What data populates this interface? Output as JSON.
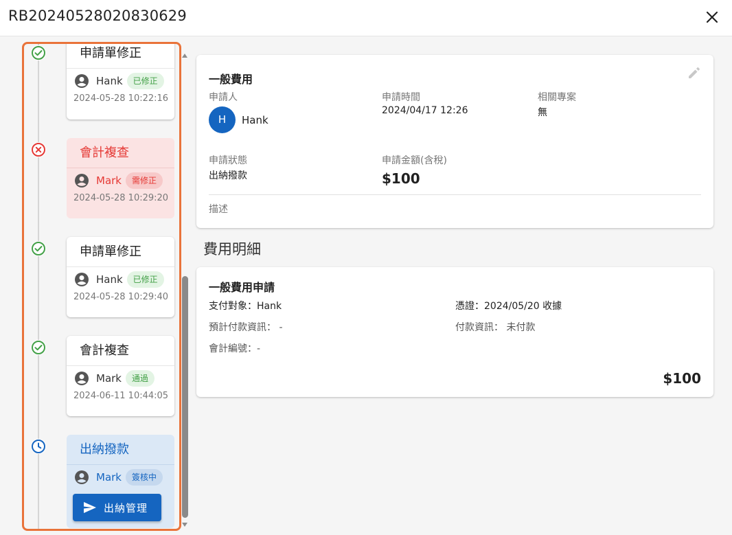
{
  "header": {
    "title": "RB20240528020830629"
  },
  "timeline": {
    "steps": [
      {
        "status": "done",
        "title": "申請單修正",
        "user": "Hank",
        "badge": "已修正",
        "time": "2024-05-28 10:22:16"
      },
      {
        "status": "rejected",
        "title": "會計複查",
        "user": "Mark",
        "badge": "需修正",
        "time": "2024-05-28 10:29:20"
      },
      {
        "status": "done",
        "title": "申請單修正",
        "user": "Hank",
        "badge": "已修正",
        "time": "2024-05-28 10:29:40"
      },
      {
        "status": "done",
        "title": "會計複查",
        "user": "Mark",
        "badge": "通過",
        "time": "2024-06-11 10:44:05"
      },
      {
        "status": "pending",
        "title": "出納撥款",
        "user": "Mark",
        "badge": "簽核中",
        "action": "出納管理"
      }
    ]
  },
  "summary": {
    "category": "一般費用",
    "applicant_label": "申請人",
    "applicant_initial": "H",
    "applicant_name": "Hank",
    "apply_time_label": "申請時間",
    "apply_time": "2024/04/17 12:26",
    "project_label": "相關專案",
    "project": "無",
    "status_label": "申請狀態",
    "status": "出納撥款",
    "amount_label": "申請金額(含稅)",
    "amount": "$100",
    "desc_label": "描述"
  },
  "details": {
    "section_title": "費用明細",
    "title": "一般費用申請",
    "payee": "支付對象：Hank",
    "voucher": "憑證：2024/05/20  收據",
    "expected_payment": "預計付款資訊：  -",
    "payment_info": "付款資訊：  未付款",
    "accounting_no": "會計編號：-",
    "total": "$100"
  },
  "colors": {
    "accent": "#e9733a",
    "primary": "#1565c0",
    "success": "#43a047",
    "error": "#e53935"
  }
}
